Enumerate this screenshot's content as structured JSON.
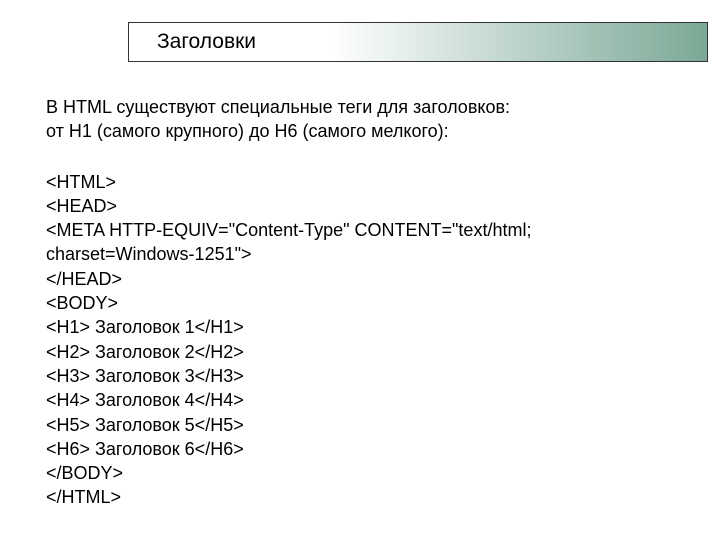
{
  "title": "Заголовки",
  "intro_line1": "В HTML существуют специальные теги для заголовков:",
  "intro_line2": "от Н1 (самого крупного) до Н6 (самого мелкого):",
  "code": {
    "line1": "<HTML>",
    "line2": "<HEAD>",
    "line3": "<META HTTP-EQUIV=\"Content-Type\" CONTENT=\"text/html;",
    "line4": "charset=Windows-1251\">",
    "line5": "</HEAD>",
    "line6": "<BODY>",
    "line7": "<H1> Заголовок 1</H1>",
    "line8": "<H2> Заголовок 2</H2>",
    "line9": "<H3> Заголовок 3</H3>",
    "line10": "<H4> Заголовок 4</H4>",
    "line11": "<H5> Заголовок 5</H5>",
    "line12": "<H6> Заголовок 6</H6>",
    "line13": "</BODY>",
    "line14": "</HTML>"
  }
}
